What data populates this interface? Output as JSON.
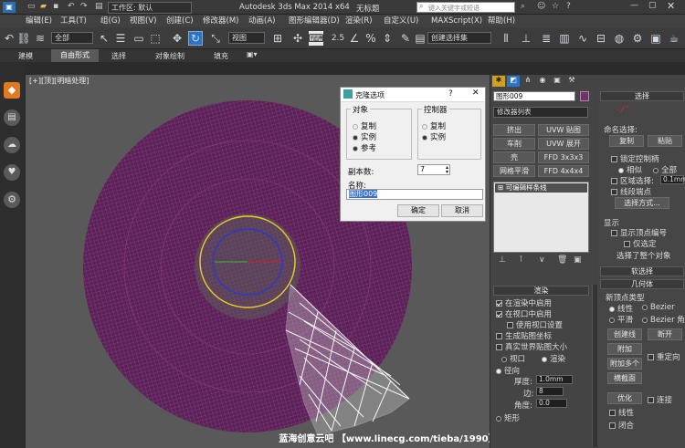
{
  "titlebar": {
    "workspace_label": "工作区: 默认",
    "app_title": "Autodesk 3ds Max  2014 x64",
    "doc_title": "无标题",
    "search_placeholder": "键入关键字或短语"
  },
  "menubar": {
    "items": [
      "编辑(E)",
      "工具(T)",
      "组(G)",
      "视图(V)",
      "创建(C)",
      "修改器(M)",
      "动画(A)",
      "图形编辑器(D)",
      "渲染(R)",
      "自定义(U)",
      "MAXScript(X)",
      "帮助(H)"
    ]
  },
  "toolbar": {
    "filter_value": "全部",
    "view_value": "视图",
    "selection_set": "创建选择集"
  },
  "ribbon": {
    "tabs": [
      "建模",
      "自由形式",
      "选择",
      "对象绘制",
      "填充"
    ]
  },
  "viewport": {
    "label": "[+][顶][明暗处理]",
    "watermark": "蓝海创意云吧 【www.linecg.com/tieba/1990】"
  },
  "dialog": {
    "title": "克隆选项",
    "help": "?",
    "close": "✕",
    "object_group": "对象",
    "object_options": [
      "复制",
      "实例",
      "参考"
    ],
    "controller_group": "控制器",
    "controller_options": [
      "复制",
      "实例"
    ],
    "copies_label": "副本数:",
    "copies_value": "7",
    "name_label": "名称:",
    "name_value": "图形009",
    "ok": "确定",
    "cancel": "取消"
  },
  "command_panel": {
    "object_name": "图形009",
    "modifier_list": "修改器列表",
    "modifier_buttons": [
      "挤出",
      "UVW 贴图",
      "车削",
      "UVW 展开",
      "壳",
      "FFD 3x3x3",
      "网格平滑",
      "FFD 4x4x4"
    ],
    "stack_item": "可编辑样条线",
    "render_header": "渲染",
    "render_options": [
      "在渲染中启用",
      "在视口中启用",
      "使用视口设置",
      "生成贴图坐标",
      "真实世界贴图大小"
    ],
    "viewport_label": "视口",
    "render_label": "渲染",
    "radial_label": "径向",
    "thickness_label": "厚度:",
    "thickness_value": "1.0mm",
    "sides_label": "边:",
    "sides_value": "8",
    "angle_label": "角度:",
    "angle_value": "0.0",
    "rect_label": "矩形"
  },
  "right_panel": {
    "select_header": "选择",
    "named_sel": "命名选择:",
    "copy": "复制",
    "paste": "粘贴",
    "lock_handles": "锁定控制柄",
    "similar": "相似",
    "all": "全部",
    "area_sel": "区域选择:",
    "area_value": "0.1mm",
    "segment_end": "线段端点",
    "sel_method": "选择方式...",
    "display_header": "显示",
    "show_vertex_num": "显示顶点编号",
    "only_selected": "仅选定",
    "selected_count": "选择了整个对象",
    "soft_sel": "软选择",
    "geometry": "几何体",
    "new_vertex_type": "新顶点类型",
    "linear": "线性",
    "bezier": "Bezier",
    "smooth": "平滑",
    "bezier_corner": "Bezier 角点",
    "create_line": "创建线",
    "break": "断开",
    "attach": "附加",
    "attach_multi": "附加多个",
    "reorient": "重定向",
    "cross_section": "横截面",
    "optimize": "优化",
    "linear2": "线性",
    "connect": "连接",
    "closed": "闭合"
  },
  "colors": {
    "accent": "#2b73c8",
    "object_color": "#7a2c70",
    "red_tick": "#ff2020"
  }
}
